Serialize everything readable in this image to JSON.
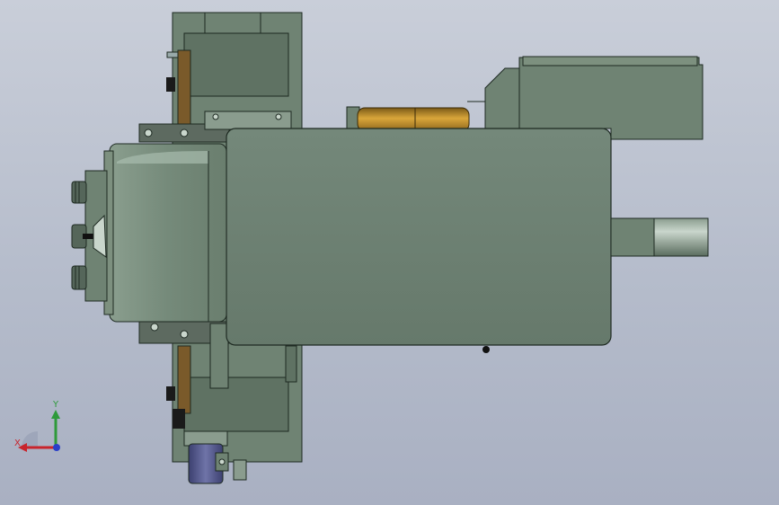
{
  "viewport": {
    "background": "#b9c0cf",
    "body_color": "#6b7f6f",
    "brass_color": "#b98a2a",
    "motor_color": "#5a5f8f"
  },
  "triad": {
    "x_label": "X",
    "y_label": "Y",
    "x_color": "#c8242c",
    "y_color": "#2e9a3a",
    "z_color": "#2a3fc8"
  }
}
